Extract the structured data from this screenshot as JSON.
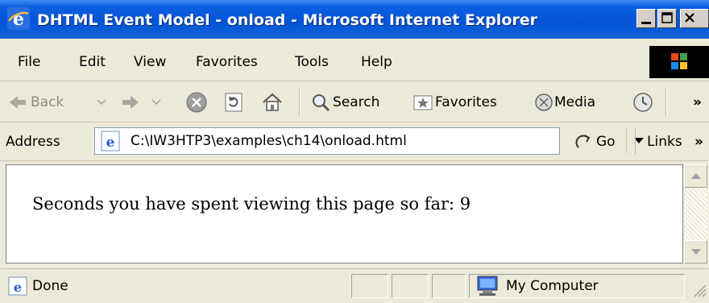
{
  "window": {
    "title": "DHTML Event Model - onload - Microsoft Internet Explorer"
  },
  "menu": {
    "items": [
      "File",
      "Edit",
      "View",
      "Favorites",
      "Tools",
      "Help"
    ]
  },
  "toolbar": {
    "back_label": "Back",
    "search_label": "Search",
    "favorites_label": "Favorites",
    "media_label": "Media",
    "overflow_label": "»"
  },
  "address": {
    "label": "Address",
    "value": "C:\\IW3HTP3\\examples\\ch14\\onload.html",
    "go_label": "Go",
    "links_label": "Links",
    "links_overflow": "»"
  },
  "content": {
    "text": "Seconds you have spent viewing this page so far: 9"
  },
  "status": {
    "text": "Done",
    "zone": "My Computer"
  },
  "colors": {
    "titlebar": "#0554d8",
    "chrome": "#ece9d8",
    "link_blue": "#1e50a2"
  }
}
